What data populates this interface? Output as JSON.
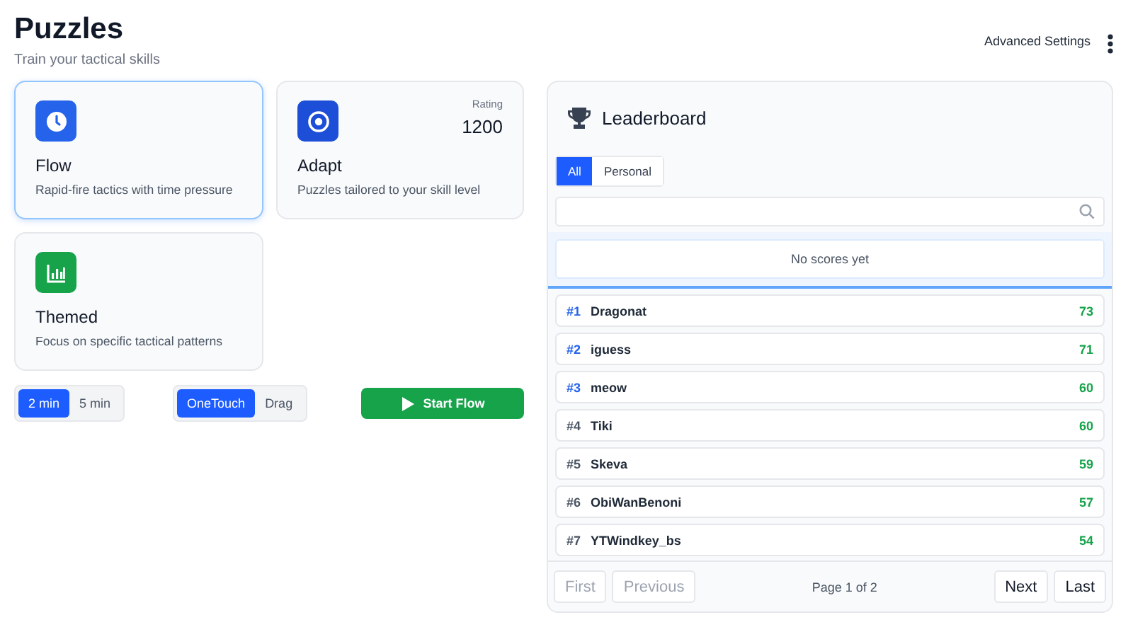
{
  "header": {
    "title": "Puzzles",
    "subtitle": "Train your tactical skills",
    "settings_link": "Advanced Settings"
  },
  "modes": [
    {
      "kind": "clock",
      "name": "Flow",
      "description": "Rapid-fire tactics with time pressure",
      "selected": true
    },
    {
      "kind": "target",
      "name": "Adapt",
      "description": "Puzzles tailored to your skill level",
      "selected": false,
      "rating_label": "Rating",
      "rating": "1200"
    },
    {
      "kind": "chart",
      "name": "Themed",
      "description": "Focus on specific tactical patterns",
      "selected": false
    }
  ],
  "durations": [
    {
      "label": "2 min",
      "selected": true
    },
    {
      "label": "5 min",
      "selected": false
    }
  ],
  "input_modes": [
    {
      "label": "OneTouch",
      "selected": true
    },
    {
      "label": "Drag",
      "selected": false
    }
  ],
  "start_button": "Start Flow",
  "leaderboard": {
    "title": "Leaderboard",
    "tabs": [
      {
        "label": "All",
        "selected": true
      },
      {
        "label": "Personal",
        "selected": false
      }
    ],
    "empty_message": "No scores yet",
    "rows": [
      {
        "rank": "#1",
        "name": "Dragonat",
        "score": "73",
        "top": true
      },
      {
        "rank": "#2",
        "name": "iguess",
        "score": "71",
        "top": true
      },
      {
        "rank": "#3",
        "name": "meow",
        "score": "60",
        "top": true
      },
      {
        "rank": "#4",
        "name": "Tiki",
        "score": "60",
        "top": false
      },
      {
        "rank": "#5",
        "name": "Skeva",
        "score": "59",
        "top": false
      },
      {
        "rank": "#6",
        "name": "ObiWanBenoni",
        "score": "57",
        "top": false
      },
      {
        "rank": "#7",
        "name": "YTWindkey_bs",
        "score": "54",
        "top": false
      }
    ],
    "pagination": {
      "buttons": [
        {
          "label": "First",
          "disabled": true
        },
        {
          "label": "Previous",
          "disabled": true
        },
        {
          "label": "Next",
          "disabled": false
        },
        {
          "label": "Last",
          "disabled": false
        }
      ],
      "page_info": "Page 1 of 2"
    }
  }
}
